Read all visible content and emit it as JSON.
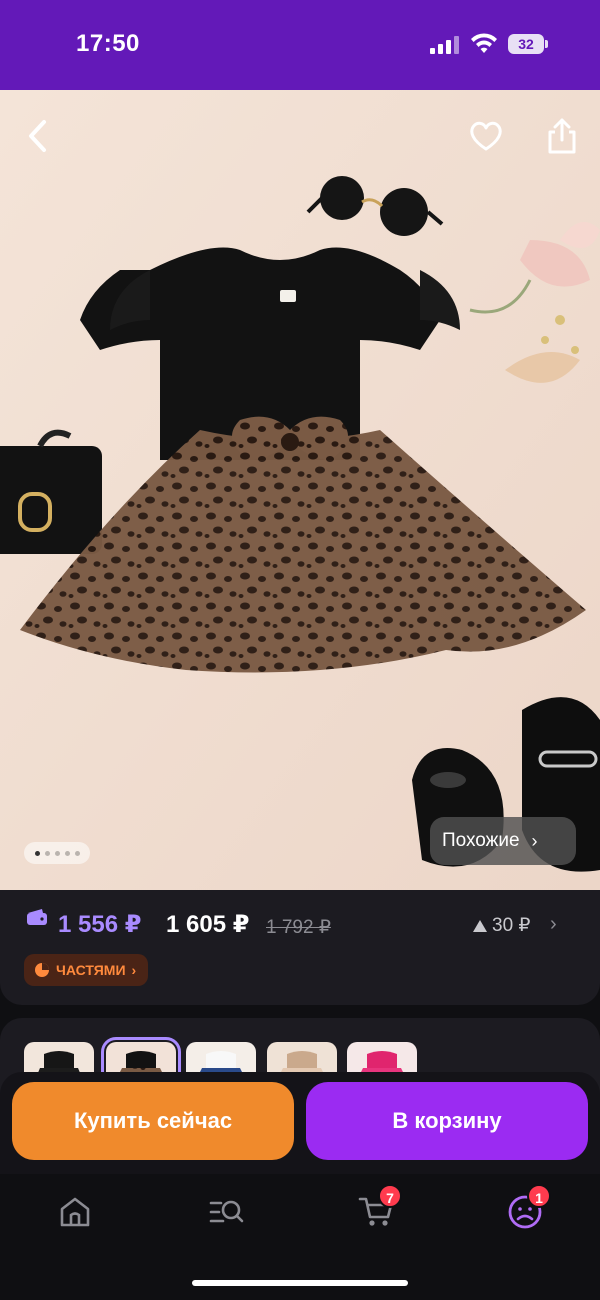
{
  "status_bar": {
    "time": "17:50",
    "battery": "32",
    "icons": [
      "signal-icon",
      "wifi-icon",
      "battery-icon"
    ]
  },
  "hero": {
    "image_count": 5,
    "active_image": 1,
    "similar_label": "Похожие",
    "icons": [
      "back-arrow-icon",
      "heart-icon",
      "share-icon"
    ]
  },
  "price": {
    "wallet_price": "1 556 ₽",
    "main_price": "1 605 ₽",
    "old_price": "1 792 ₽",
    "delta": "30 ₽",
    "installments_label": "ЧАСТЯМИ"
  },
  "variants": {
    "count": 5,
    "selected": 2
  },
  "actions": {
    "buy_now": "Купить сейчас",
    "add_to_cart": "В корзину"
  },
  "nav": {
    "items": [
      "home",
      "catalog-search",
      "cart",
      "profile"
    ],
    "cart_badge": "7",
    "profile_badge": "1"
  },
  "colors": {
    "status_bar": "#6319b8",
    "wallet_price": "#a98bff",
    "buy_button": "#f08a2c",
    "cart_button": "#9b2bf2",
    "installments": "#ff8a3d",
    "badge": "#ff3b4e"
  }
}
